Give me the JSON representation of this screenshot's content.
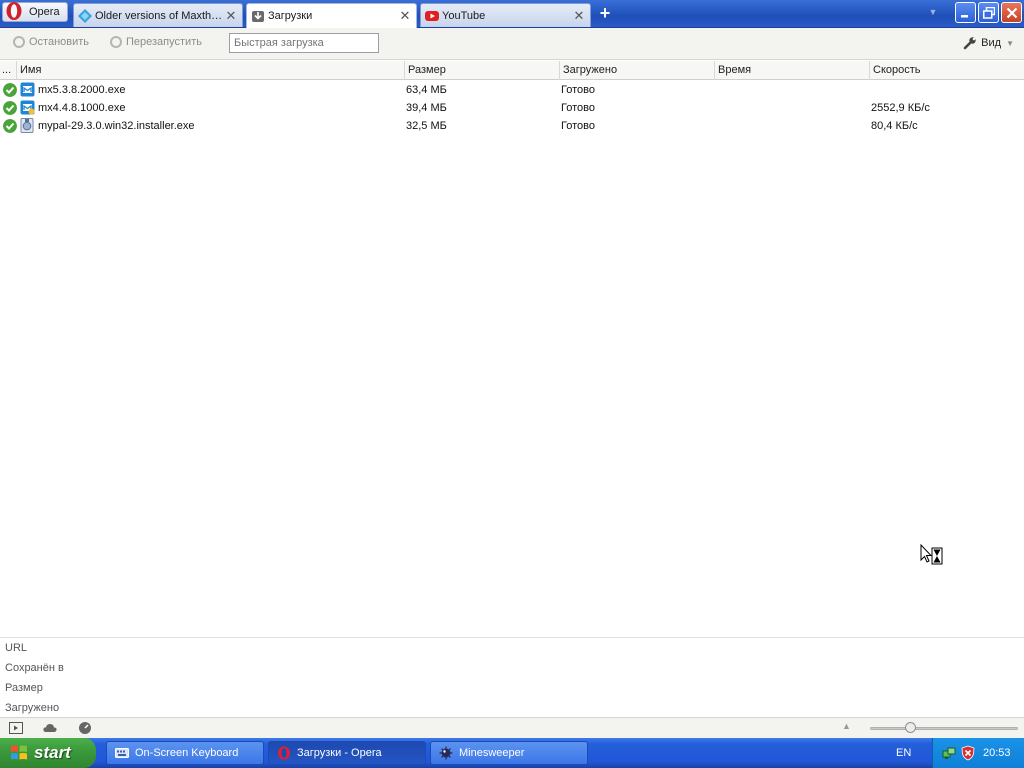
{
  "browser": {
    "menu_button_label": "Opera",
    "tabs": [
      {
        "label": "Older versions of Maxth…",
        "icon": "maxthon-icon"
      },
      {
        "label": "Загрузки",
        "icon": "downloads-icon"
      },
      {
        "label": "YouTube",
        "icon": "youtube-icon"
      }
    ],
    "new_tab_symbol": "+"
  },
  "toolbar": {
    "stop_label": "Остановить",
    "restart_label": "Перезапустить",
    "quick_placeholder": "Быстрая загрузка",
    "view_label": "Вид"
  },
  "table": {
    "headers": {
      "status": "...",
      "name": "Имя",
      "size": "Размер",
      "downloaded": "Загружено",
      "time": "Время",
      "speed": "Скорость"
    },
    "rows": [
      {
        "name": "mx5.3.8.2000.exe",
        "size": "63,4 МБ",
        "downloaded": "Готово",
        "time": "",
        "speed": ""
      },
      {
        "name": "mx4.4.8.1000.exe",
        "size": "39,4 МБ",
        "downloaded": "Готово",
        "time": "",
        "speed": "2552,9 КБ/с"
      },
      {
        "name": "mypal-29.3.0.win32.installer.exe",
        "size": "32,5 МБ",
        "downloaded": "Готово",
        "time": "",
        "speed": "80,4 КБ/с"
      }
    ]
  },
  "details": {
    "url_label": "URL",
    "saved_label": "Сохранён в",
    "size_label": "Размер",
    "downloaded_label": "Загружено"
  },
  "taskbar": {
    "start_label": "start",
    "tasks": [
      {
        "label": "On-Screen Keyboard",
        "icon": "keyboard-icon"
      },
      {
        "label": "Загрузки - Opera",
        "icon": "opera-icon"
      },
      {
        "label": "Minesweeper",
        "icon": "minesweeper-icon"
      }
    ],
    "language": "EN",
    "clock": "20:53"
  },
  "colors": {
    "tab_bar": "#2a5bc8",
    "success_green": "#4aa43a",
    "taskbar_blue": "#245edb",
    "start_green": "#3c9a3c"
  }
}
